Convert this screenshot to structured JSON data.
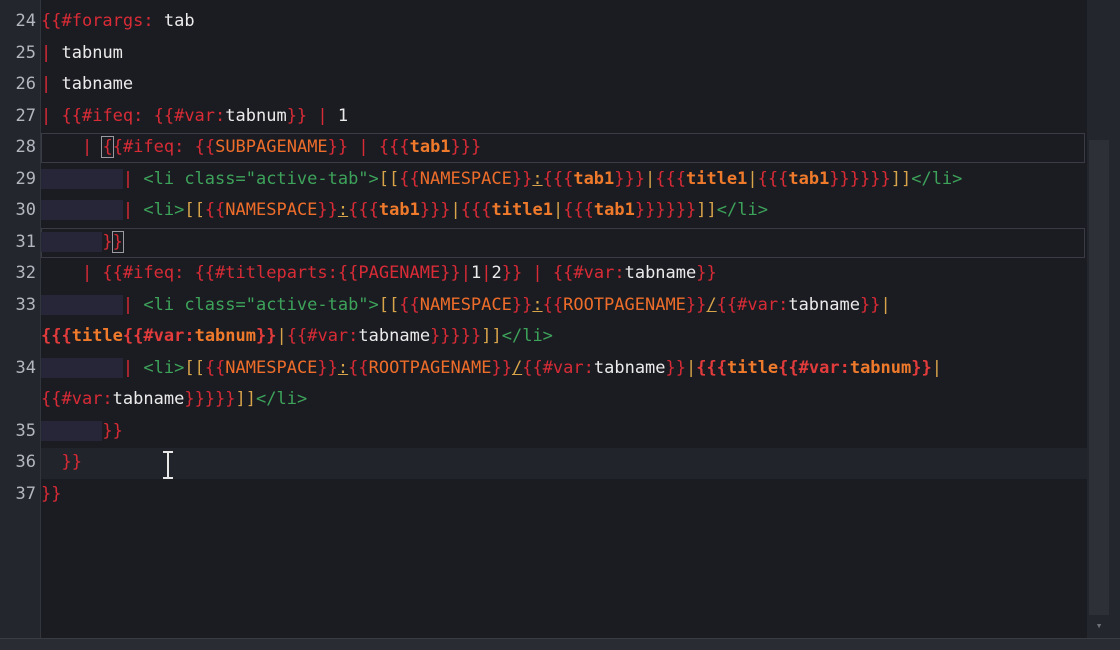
{
  "editor": {
    "line_numbers": [
      "24",
      "25",
      "26",
      "27",
      "28",
      "29",
      "30",
      "31",
      "32",
      "33",
      "34",
      "35",
      "36",
      "37"
    ],
    "line28": {
      "kw": "#ifeq: ",
      "name": "SUBPAGENAME",
      "param": "tab1"
    },
    "line29": {
      "li_open": "<li class=\"active-tab\">",
      "ns": "NAMESPACE",
      "p1": "tab1",
      "p2": "title1",
      "p3": "tab1",
      "li_close": "</li>"
    },
    "line30": {
      "li_open": "<li>",
      "ns": "NAMESPACE",
      "p1": "tab1",
      "p2": "title1",
      "p3": "tab1",
      "li_close": "</li>"
    },
    "line32": {
      "kw": "#ifeq: ",
      "fn": "#titleparts:",
      "arg": "PAGENAME",
      "n1": "1",
      "n2": "2",
      "var": "#var:",
      "vname": "tabname"
    },
    "line33": {
      "li_open": "<li class=\"active-tab\">",
      "ns": "NAMESPACE",
      "root": "ROOTPAGENAME",
      "var": "#var:",
      "vname": "tabname"
    },
    "line33b": {
      "title": "title",
      "var": "#var:",
      "num": "tabnum",
      "vname": "tabname",
      "li_close": "</li>"
    },
    "line34": {
      "li_open": "<li>",
      "ns": "NAMESPACE",
      "root": "ROOTPAGENAME",
      "var": "#var:",
      "vname": "tabname",
      "title": "title",
      "num": "tabnum"
    },
    "line34b": {
      "var": "#var:",
      "vname": "tabname",
      "li_close": "</li>"
    }
  }
}
